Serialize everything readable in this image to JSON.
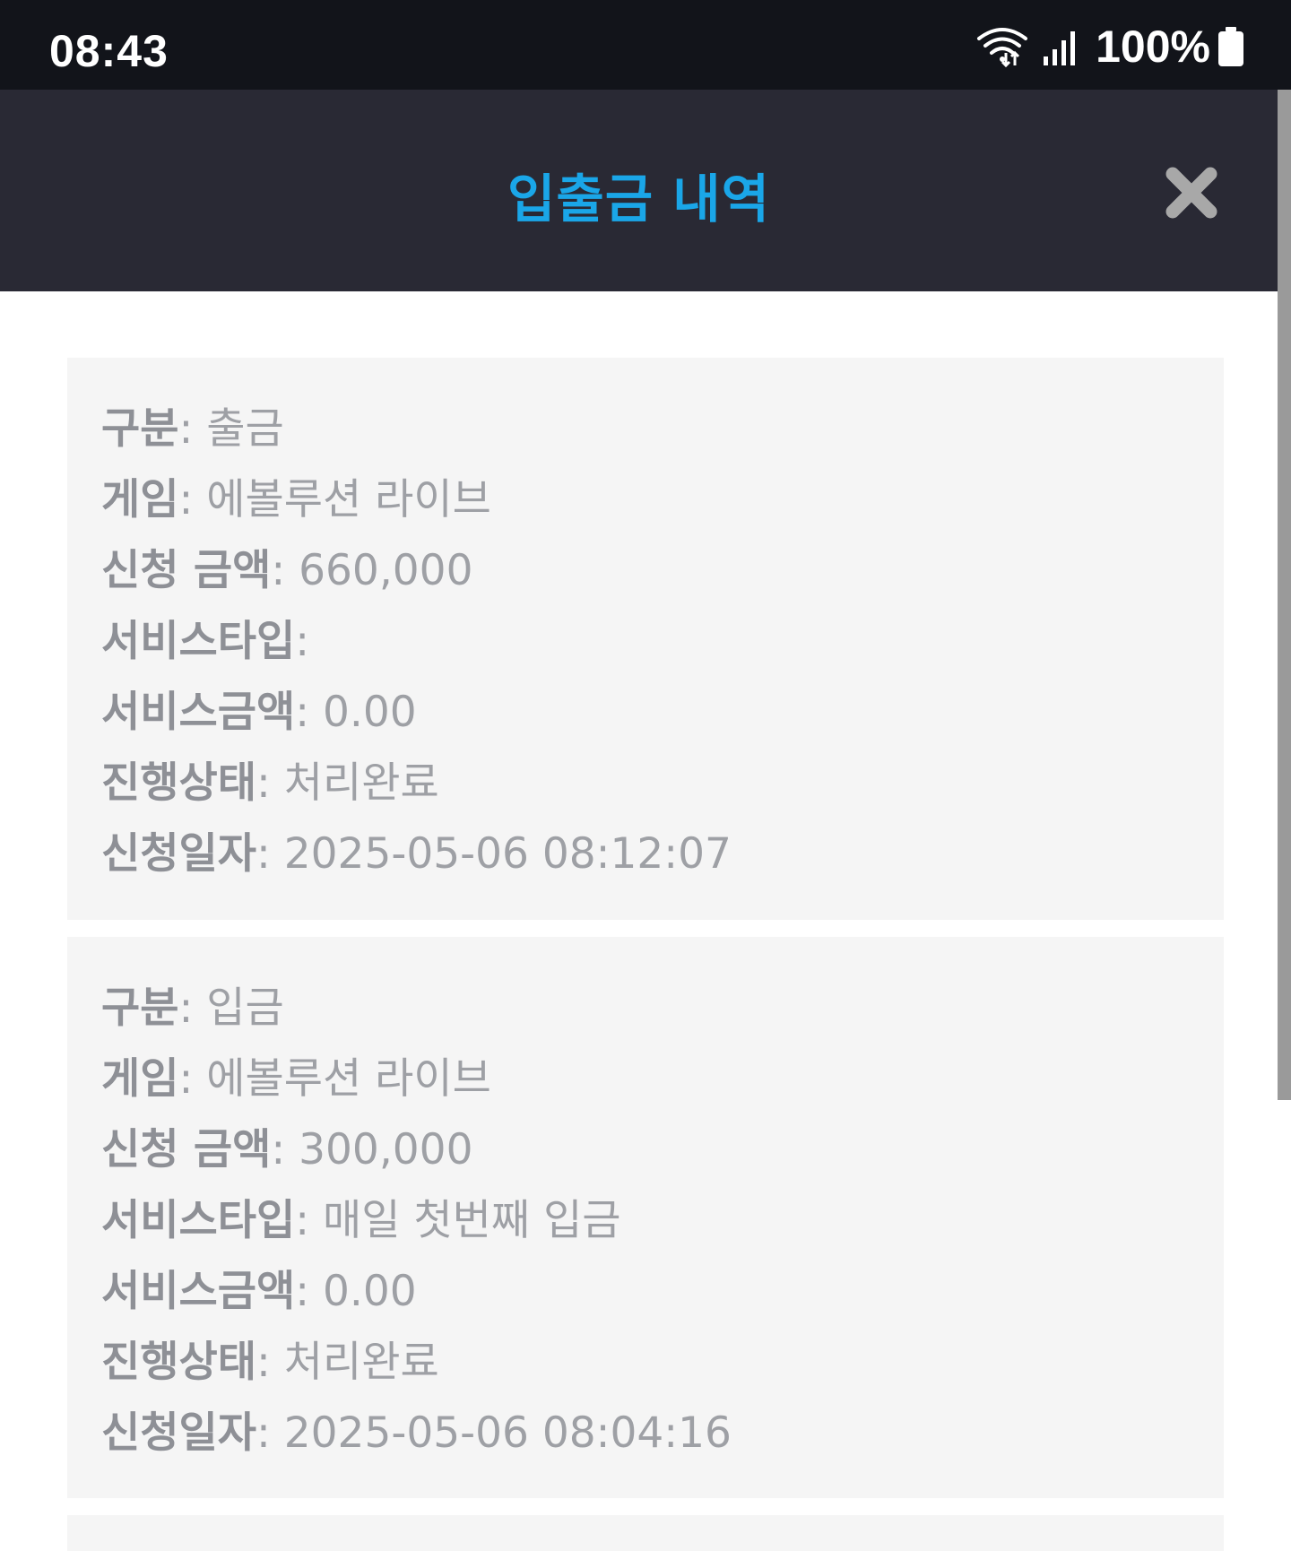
{
  "status_bar": {
    "time": "08:43",
    "battery": "100%",
    "icons": [
      "wifi-icon",
      "signal-icon",
      "battery-icon"
    ]
  },
  "header": {
    "title": "입출금 내역",
    "title_color": "#1aa6e8",
    "background": "#292934",
    "close_icon": "close-icon"
  },
  "records": [
    {
      "fields": [
        {
          "label": "구분",
          "value": "출금"
        },
        {
          "label": "게임",
          "value": "에볼루션 라이브"
        },
        {
          "label": "신청 금액",
          "value": "660,000"
        },
        {
          "label": "서비스타입",
          "value": ""
        },
        {
          "label": "서비스금액",
          "value": "0.00"
        },
        {
          "label": "진행상태",
          "value": "처리완료"
        },
        {
          "label": "신청일자",
          "value": "2025-05-06 08:12:07"
        }
      ]
    },
    {
      "fields": [
        {
          "label": "구분",
          "value": "입금"
        },
        {
          "label": "게임",
          "value": "에볼루션 라이브"
        },
        {
          "label": "신청 금액",
          "value": "300,000"
        },
        {
          "label": "서비스타입",
          "value": "매일 첫번째 입금"
        },
        {
          "label": "서비스금액",
          "value": "0.00"
        },
        {
          "label": "진행상태",
          "value": "처리완료"
        },
        {
          "label": "신청일자",
          "value": "2025-05-06 08:04:16"
        }
      ]
    }
  ],
  "separator": ": "
}
